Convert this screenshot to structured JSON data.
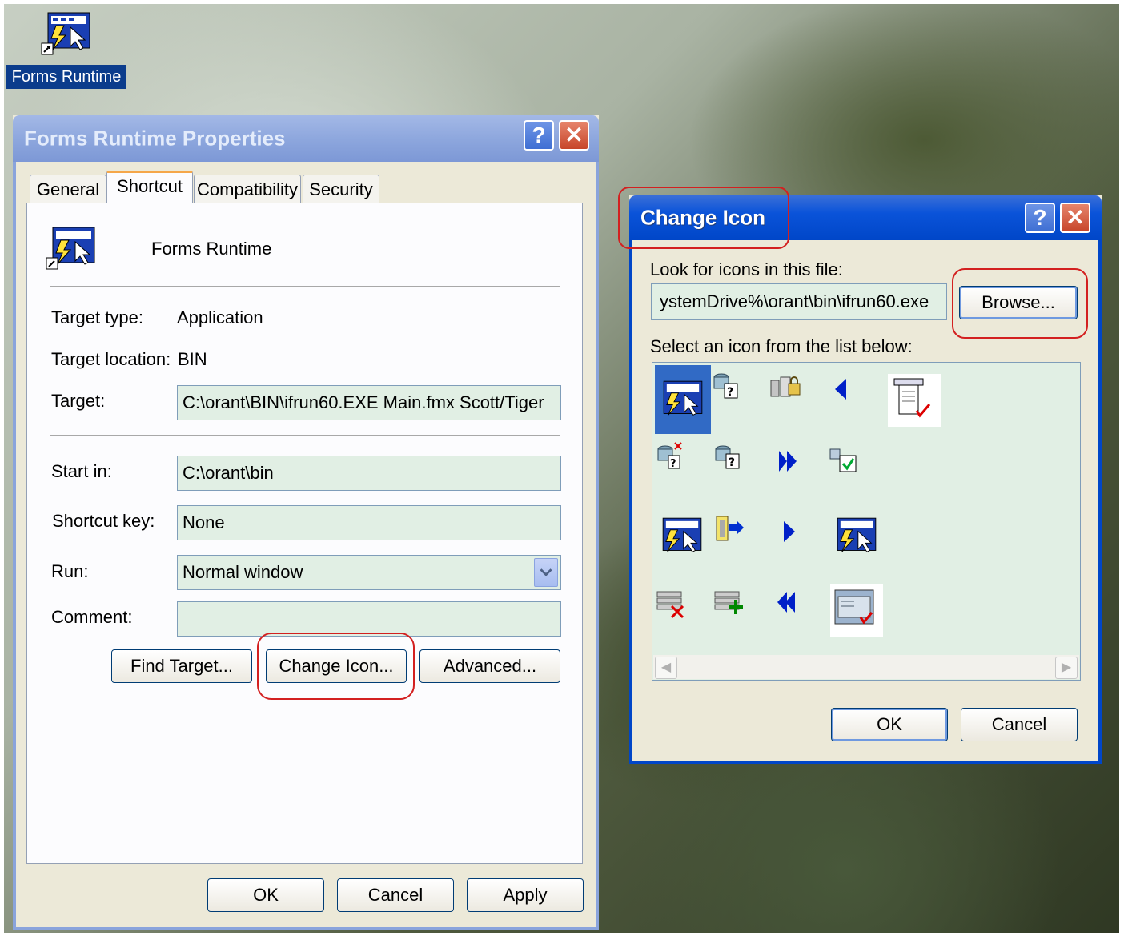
{
  "desktop": {
    "shortcut_label": "Forms Runtime",
    "shortcut_icon": "forms-runtime-icon"
  },
  "properties": {
    "title": "Forms Runtime Properties",
    "help_glyph": "?",
    "close_glyph": "✕",
    "tabs": [
      {
        "label": "General"
      },
      {
        "label": "Shortcut"
      },
      {
        "label": "Compatibility"
      },
      {
        "label": "Security"
      }
    ],
    "active_tab": "Shortcut",
    "app_name": "Forms Runtime",
    "target_type_label": "Target type:",
    "target_type_value": "Application",
    "target_location_label": "Target location:",
    "target_location_value": "BIN",
    "target_label": "Target:",
    "target_value": "C:\\orant\\BIN\\ifrun60.EXE Main.fmx Scott/Tiger",
    "start_in_label": "Start in:",
    "start_in_value": "C:\\orant\\bin",
    "shortcut_key_label": "Shortcut key:",
    "shortcut_key_value": "None",
    "run_label": "Run:",
    "run_value": "Normal window",
    "comment_label": "Comment:",
    "comment_value": "",
    "find_target_button": "Find Target...",
    "change_icon_button": "Change Icon...",
    "advanced_button": "Advanced...",
    "ok_button": "OK",
    "cancel_button": "Cancel",
    "apply_button": "Apply"
  },
  "change_icon": {
    "title": "Change Icon",
    "help_glyph": "?",
    "close_glyph": "✕",
    "look_for_label": "Look for icons in this file:",
    "file_path": "ystemDrive%\\orant\\bin\\ifrun60.exe",
    "browse_button": "Browse...",
    "select_label": "Select an icon from the list below:",
    "icons": [
      "forms-runtime-icon",
      "query-database-icon",
      "database-lock-icon",
      "arrow-left-icon",
      "document-check-icon",
      "database-delete-icon",
      "database-query-icon",
      "double-arrow-right-icon",
      "checkbox-icon",
      "forms-runtime-icon-large",
      "exit-door-icon",
      "arrow-right-icon",
      "forms-runtime-icon-alt",
      "record-delete-icon",
      "record-insert-icon",
      "double-arrow-left-icon",
      "window-check-icon"
    ],
    "selected_icon_index": 0,
    "ok_button": "OK",
    "cancel_button": "Cancel"
  },
  "colors": {
    "highlight_circle": "#d32020",
    "title_bar": "#5b85d6",
    "field_background": "#e1efe4",
    "selection": "#316ac5"
  }
}
